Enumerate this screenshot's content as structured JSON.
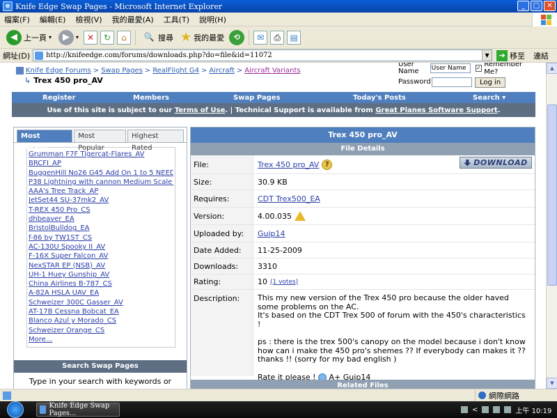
{
  "window": {
    "title": "Knife Edge Swap Pages - Microsoft Internet Explorer"
  },
  "menu": [
    "檔案(F)",
    "編輯(E)",
    "檢視(V)",
    "我的最愛(A)",
    "工具(T)",
    "說明(H)"
  ],
  "toolbar": {
    "back_label": "上一頁",
    "search_label": "搜尋",
    "favorites_label": "我的最愛"
  },
  "addressbar": {
    "label": "網址(D)",
    "url": "http://knifeedge.com/forums/downloads.php?do=file&id=11072",
    "go_label": "移至",
    "links_label": "連結"
  },
  "breadcrumb": {
    "items": [
      "Knife Edge Forums",
      "Swap Pages",
      "RealFlight G4",
      "Aircraft",
      "Aircraft Variants"
    ],
    "current": "Trex 450 pro_AV"
  },
  "login": {
    "user_label": "User Name",
    "user_value": "User Name",
    "remember_label": "Remember Me?",
    "password_label": "Password",
    "login_button": "Log in"
  },
  "navbar": {
    "items": [
      "Register",
      "Members",
      "Swap Pages",
      "Today's Posts",
      "Search ▾"
    ]
  },
  "notice": {
    "pre": "Use of this site is subject to our ",
    "terms": "Terms of Use",
    "mid": ". | Technical Support is available from ",
    "support": "Great Planes Software Support",
    "post": "."
  },
  "left_panel": {
    "tabs": [
      "Most Recent",
      "Most Popular",
      "Highest Rated"
    ],
    "files": [
      "Grumman F7F Tigercat-Flares_AV",
      "BRCFI_AP",
      "BuggenHill No26 G45 Add On 1 to 5 NEEDED",
      "P38 Lightning with cannon Medium Scale_",
      "AAA's Tree Track_AP",
      "JetSet44 SU-37mk2_AV",
      "T-REX 450 Pro_CS",
      "dhbeaver_EA",
      "BristolBulldog_EA",
      "f-86 by TW1ST_CS",
      "AC-130U Spooky II_AV",
      "F-16X Super Falcon_AV",
      "NexSTAR EP (NSB)_AV",
      "UH-1 Huey Gunship_AV",
      "China Airlines B-787_CS",
      "A-82A HSLA UAV_EA",
      "Schweizer 300C Gasser_AV",
      "AT-17B Cessna Bobcat_EA",
      "Blanco Azul y Morado_CS",
      "Schweizer Orange_CS"
    ],
    "more_label": "More...",
    "search_header": "Search Swap Pages",
    "search_text": "Type in your search with keywords or"
  },
  "file": {
    "title": "Trex 450 pro_AV",
    "section": "File Details",
    "labels": {
      "file": "File:",
      "size": "Size:",
      "requires": "Requires:",
      "version": "Version:",
      "uploaded_by": "Uploaded by:",
      "date_added": "Date Added:",
      "downloads": "Downloads:",
      "rating": "Rating:",
      "description": "Description:"
    },
    "name": "Trex 450 pro_AV",
    "download_label": "DOWNLOAD",
    "size": "30.9 KB",
    "requires": "CDT Trex500_EA",
    "version": "4.00.035",
    "uploaded_by": "Guip14",
    "date_added": "11-25-2009",
    "downloads": "3310",
    "rating": "10",
    "rating_votes": "(1 votes)",
    "description": [
      "This my new version of the Trex 450 pro because the older haved some problems on the AC.",
      "It's based on the CDT Trex 500 of forum with the 450's characteristics !",
      "ps : there is the trex 500's canopy on the model because i don't know how can i make the 450 pro's shemes ?? If everybody can makes it ?? thanks !! (sorry for my bad english )"
    ],
    "description_end_pre": "Rate it please ! ",
    "description_end_post": " A+ Guip14",
    "related_header": "Related Files"
  },
  "statusbar": {
    "zone": "網際網路"
  },
  "taskbar": {
    "task": "Knife Edge Swap Pages...",
    "time": "上午 10:19"
  }
}
